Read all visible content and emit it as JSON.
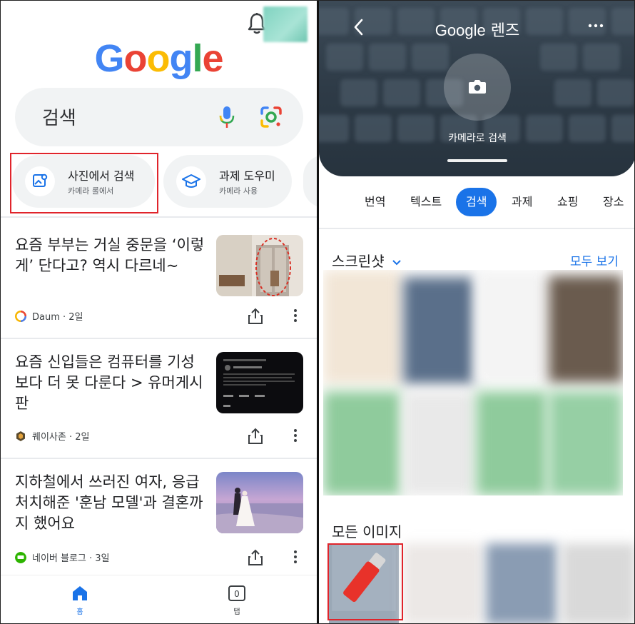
{
  "left": {
    "logo": {
      "letters": [
        "G",
        "o",
        "o",
        "g",
        "l",
        "e"
      ],
      "colors": [
        "#4285F4",
        "#EA4335",
        "#FBBC05",
        "#4285F4",
        "#34A853",
        "#EA4335"
      ]
    },
    "search": {
      "placeholder": "검색"
    },
    "chips": [
      {
        "title": "사진에서 검색",
        "subtitle": "카메라 롤에서"
      },
      {
        "title": "과제 도우미",
        "subtitle": "카메라 사용"
      }
    ],
    "articles": [
      {
        "title": "요즘 부부는 거실 중문을 ‘이렇게’ 단다고? 역시 다르네~",
        "source": "Daum · 2일"
      },
      {
        "title": "요즘 신입들은 컴퓨터를 기성보다 더 못 다룬다 > 유머게시판",
        "source": "퀘이사존 · 2일"
      },
      {
        "title": "지하철에서 쓰러진 여자, 응급처치해준 '훈남 모델'과 결혼까지 했어요",
        "source": "네이버 블로그 · 3일"
      }
    ],
    "bottom_nav": {
      "home_label": "홈",
      "tabs_label": "탭",
      "tabs_count": "0"
    },
    "accent": "#1a73e8",
    "highlight_color": "#e0242b"
  },
  "right": {
    "header": {
      "title_brand": "Google",
      "title_suffix": " 렌즈"
    },
    "camera_label": "카메라로 검색",
    "tabs": [
      "번역",
      "텍스트",
      "검색",
      "과제",
      "쇼핑",
      "장소"
    ],
    "active_tab": "검색",
    "screenshots_title": "스크린샷",
    "see_all": "모두 보기",
    "all_images_title": "모든 이미지"
  }
}
